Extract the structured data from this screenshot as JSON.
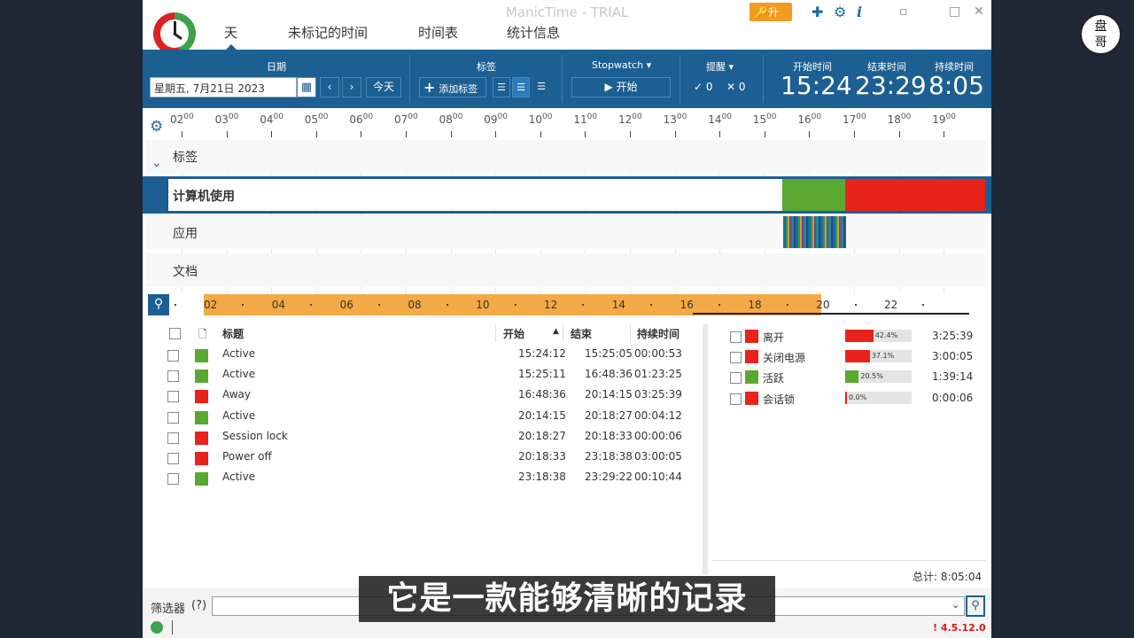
{
  "window": {
    "title": "ManicTime - TRIAL",
    "upgrade_label": "升级",
    "icons": [
      "puzzle-icon",
      "gear-icon",
      "info-icon"
    ],
    "controls": [
      "▫",
      "□",
      "✕"
    ]
  },
  "nav": {
    "tabs": [
      {
        "label": "天",
        "active": true
      },
      {
        "label": "未标记的时间"
      },
      {
        "label": "时间表"
      },
      {
        "label": "统计信息"
      }
    ]
  },
  "toolbar": {
    "date_label": "日期",
    "date_value": "星期五, 7月21日 2023",
    "today_label": "今天",
    "tags_label": "标签",
    "add_tag_label": "添加标签",
    "stopwatch_label": "Stopwatch ▾",
    "start_label": "开始",
    "reminder_label": "提醒 ▾",
    "reminder_ok": "✓ 0",
    "reminder_x": "✕ 0",
    "start_time_label": "开始时间",
    "start_time": "15:24",
    "end_time_label": "结束时间",
    "end_time": "23:29",
    "duration_label": "持续时间",
    "duration": "8:05"
  },
  "timeline": {
    "hours": [
      "02",
      "03",
      "04",
      "05",
      "06",
      "07",
      "08",
      "09",
      "10",
      "11",
      "12",
      "13",
      "14",
      "15",
      "16",
      "17",
      "18",
      "19"
    ],
    "hour_suffix": "00",
    "rows": {
      "tags": "标签",
      "computer": "计算机使用",
      "apps": "应用",
      "docs": "文档"
    },
    "computer_segments": [
      {
        "start": 15.4,
        "end": 16.81,
        "color": "#5aa832"
      },
      {
        "start": 16.81,
        "end": 19.95,
        "color": "#e8231b"
      }
    ],
    "zoom_labels": [
      "02",
      "04",
      "06",
      "08",
      "10",
      "12",
      "14",
      "16",
      "18",
      "20",
      "22"
    ],
    "zoom_highlight": [
      2,
      20
    ]
  },
  "grid": {
    "headers": {
      "title": "标题",
      "start": "开始",
      "end": "结束",
      "duration": "持续时间"
    },
    "rows": [
      {
        "title": "Active",
        "start": "15:24:12",
        "end": "15:25:05",
        "duration": "00:00:53",
        "color": "#5aa832"
      },
      {
        "title": "Active",
        "start": "15:25:11",
        "end": "16:48:36",
        "duration": "01:23:25",
        "color": "#5aa832"
      },
      {
        "title": "Away",
        "start": "16:48:36",
        "end": "20:14:15",
        "duration": "03:25:39",
        "color": "#e8231b"
      },
      {
        "title": "Active",
        "start": "20:14:15",
        "end": "20:18:27",
        "duration": "00:04:12",
        "color": "#5aa832"
      },
      {
        "title": "Session lock",
        "start": "20:18:27",
        "end": "20:18:33",
        "duration": "00:00:06",
        "color": "#e8231b"
      },
      {
        "title": "Power off",
        "start": "20:18:33",
        "end": "23:18:38",
        "duration": "03:00:05",
        "color": "#e8231b"
      },
      {
        "title": "Active",
        "start": "23:18:38",
        "end": "23:29:22",
        "duration": "00:10:44",
        "color": "#5aa832"
      }
    ]
  },
  "summary": {
    "rows": [
      {
        "label": "离开",
        "pct_text": "42.4%",
        "pct": 0.424,
        "time": "3:25:39",
        "color": "#e8231b"
      },
      {
        "label": "关闭电源",
        "pct_text": "37.1%",
        "pct": 0.371,
        "time": "3:00:05",
        "color": "#e8231b"
      },
      {
        "label": "活跃",
        "pct_text": "20.5%",
        "pct": 0.205,
        "time": "1:39:14",
        "color": "#5aa832"
      },
      {
        "label": "会话锁",
        "pct_text": "0.0%",
        "pct": 0.0,
        "time": "0:00:06",
        "color": "#e8231b"
      }
    ],
    "total": "总计: 8:05:04"
  },
  "filter": {
    "label": "筛选器",
    "help": "(?)",
    "version": "! 4.5.12.0"
  },
  "subtitle": "它是一款能够清晰的记录",
  "watermark": "盘\n哥"
}
